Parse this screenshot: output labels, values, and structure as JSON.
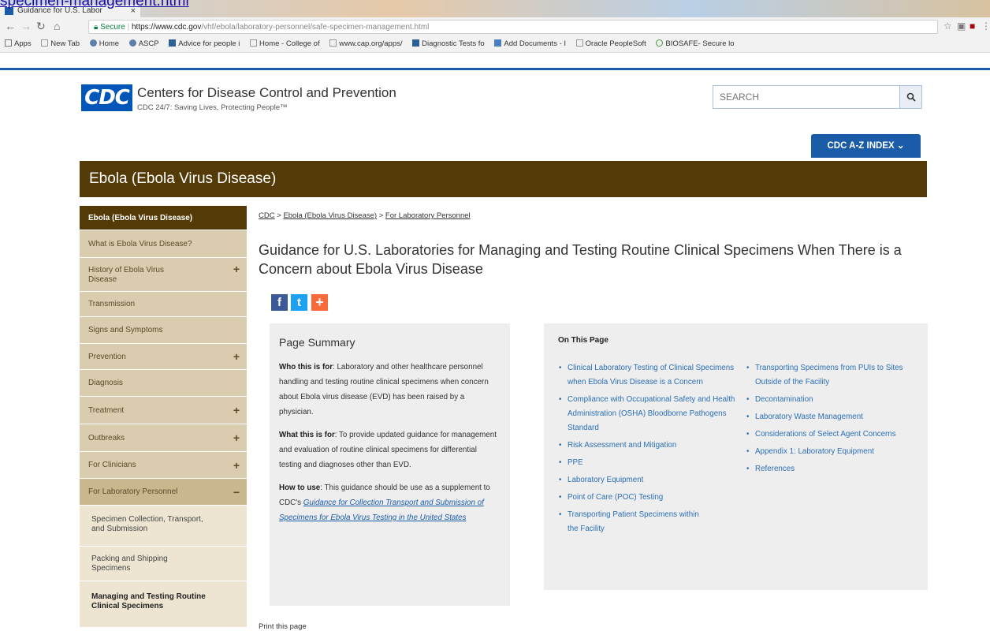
{
  "top_link": "specimen-management.html",
  "browser": {
    "tab_title": "Guidance for U.S. Labor",
    "tab_close": "×",
    "secure_label": "Secure",
    "url_host": "https://www.cdc.gov",
    "url_path": "/vhf/ebola/laboratory-personnel/safe-specimen-management.html",
    "bookmarks": [
      "Apps",
      "New Tab",
      "Home",
      "ASCP",
      "Advice for people i",
      "Home - College of",
      "www.cap.org/apps/",
      "Diagnostic Tests fo",
      "Add Documents - I",
      "Oracle PeopleSoft",
      "BIOSAFE- Secure lo"
    ]
  },
  "header": {
    "logo_text": "CDC",
    "org_name": "Centers for Disease Control and Prevention",
    "tagline": "CDC 24/7: Saving Lives, Protecting People™",
    "search_placeholder": "SEARCH",
    "az_index_label": "CDC A-Z INDEX ⌄"
  },
  "topic_title": "Ebola (Ebola Virus Disease)",
  "sidebar": {
    "items": [
      {
        "label": "Ebola (Ebola Virus Disease)",
        "expandable": false
      },
      {
        "label": "What is Ebola Virus Disease?",
        "expandable": false
      },
      {
        "label": "History of Ebola Virus Disease",
        "expandable": true,
        "toggle": "+"
      },
      {
        "label": "Transmission",
        "expandable": false
      },
      {
        "label": "Signs and Symptoms",
        "expandable": false
      },
      {
        "label": "Prevention",
        "expandable": true,
        "toggle": "+"
      },
      {
        "label": "Diagnosis",
        "expandable": false
      },
      {
        "label": "Treatment",
        "expandable": true,
        "toggle": "+"
      },
      {
        "label": "Outbreaks",
        "expandable": true,
        "toggle": "+"
      },
      {
        "label": "For Clinicians",
        "expandable": true,
        "toggle": "+"
      },
      {
        "label": "For Laboratory Personnel",
        "expandable": true,
        "toggle": "−"
      }
    ],
    "subitems": [
      {
        "label": "Specimen Collection, Transport, and Submission"
      },
      {
        "label": "Packing and Shipping Specimens"
      },
      {
        "label": "Managing and Testing Routine Clinical Specimens"
      }
    ]
  },
  "breadcrumb": {
    "items": [
      "CDC",
      "Ebola (Ebola Virus Disease)",
      "For Laboratory Personnel"
    ],
    "separator": ">"
  },
  "page_title": "Guidance for U.S. Laboratories for Managing and Testing Routine Clinical Specimens When There is a Concern about Ebola Virus Disease",
  "social": {
    "facebook": "f",
    "twitter": "t",
    "addthis": "+"
  },
  "summary": {
    "heading": "Page Summary",
    "who_label": "Who this is for",
    "who_text": ": Laboratory and other healthcare personnel handling and testing routine clinical specimens when concern about Ebola virus disease (EVD) has been raised by a physician.",
    "what_label": "What this is for",
    "what_text": ": To provide updated guidance for management and evaluation of routine clinical specimens for differential testing and diagnoses other than EVD.",
    "how_label": "How to use",
    "how_text": ": This guidance should be use as a supplement to CDC's ",
    "how_link": "Guidance for Collection Transport and Submission of Specimens for Ebola Virus Testing in the United States"
  },
  "on_this_page": {
    "heading": "On This Page",
    "col1": [
      "Clinical Laboratory Testing of Clinical Specimens when Ebola Virus Disease is a Concern",
      "Compliance with Occupational Safety and Health Administration (OSHA) Bloodborne Pathogens Standard",
      "Risk Assessment and Mitigation",
      "PPE",
      "Laboratory Equipment",
      "Point of Care (POC) Testing",
      "Transporting Patient Specimens within the Facility"
    ],
    "col2": [
      "Transporting Specimens from PUIs to Sites Outside of the Facility",
      "Decontamination",
      "Laboratory Waste Management",
      "Considerations of Select Agent Concerns",
      "Appendix 1: Laboratory Equipment",
      "References"
    ]
  },
  "print_label": "Print this page",
  "colors": {
    "cdc_blue": "#1a5ca8",
    "topic_brown": "#543a07",
    "sidebar_tan": "#d9ccaf"
  }
}
